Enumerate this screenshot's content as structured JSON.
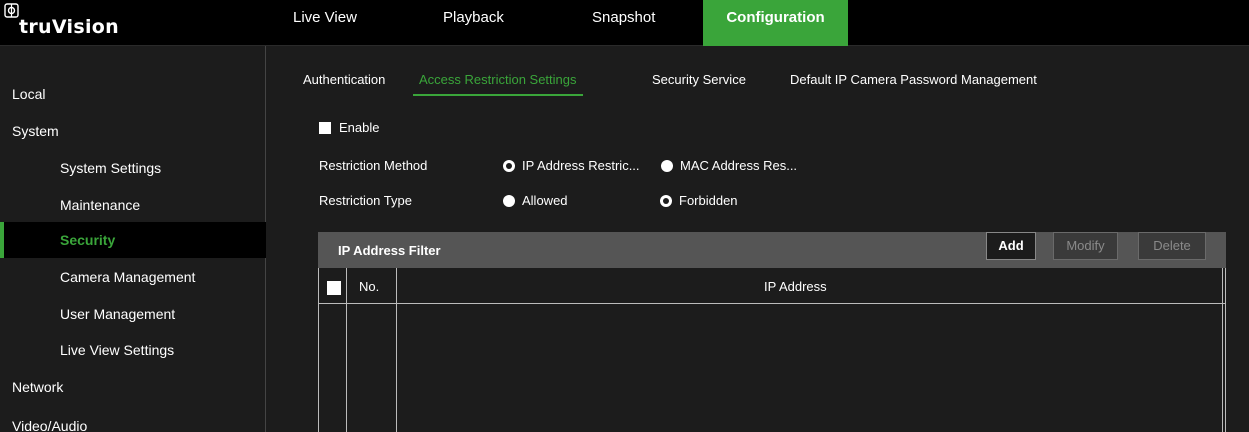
{
  "app": {
    "logo_text": "truVision"
  },
  "nav": {
    "items": [
      {
        "label": "Live View",
        "active": false
      },
      {
        "label": "Playback",
        "active": false
      },
      {
        "label": "Snapshot",
        "active": false
      },
      {
        "label": "Configuration",
        "active": true
      }
    ]
  },
  "sidebar": {
    "items": [
      {
        "label": "Local",
        "level": 0
      },
      {
        "label": "System",
        "level": 0
      },
      {
        "label": "System Settings",
        "level": 1
      },
      {
        "label": "Maintenance",
        "level": 1
      },
      {
        "label": "Security",
        "level": 1,
        "active": true
      },
      {
        "label": "Camera Management",
        "level": 1
      },
      {
        "label": "User Management",
        "level": 1
      },
      {
        "label": "Live View Settings",
        "level": 1
      },
      {
        "label": "Network",
        "level": 0
      },
      {
        "label": "Video/Audio",
        "level": 0
      }
    ]
  },
  "subtabs": [
    {
      "label": "Authentication",
      "active": false
    },
    {
      "label": "Access Restriction Settings",
      "active": true
    },
    {
      "label": "Security Service",
      "active": false
    },
    {
      "label": "Default IP Camera Password Management",
      "active": false
    }
  ],
  "form": {
    "enable_label": "Enable",
    "enable_checked": false,
    "method_label": "Restriction Method",
    "method_options": [
      "IP Address Restric...",
      "MAC Address Res..."
    ],
    "method_selected": "IP Address Restric...",
    "type_label": "Restriction Type",
    "type_options": [
      "Allowed",
      "Forbidden"
    ],
    "type_selected": "Forbidden"
  },
  "filter": {
    "title": "IP Address Filter",
    "buttons": {
      "add": "Add",
      "modify": "Modify",
      "delete": "Delete"
    },
    "columns": {
      "no": "No.",
      "ip": "IP Address"
    },
    "rows": []
  },
  "colors": {
    "accent": "#3aa53a",
    "background": "#1c1c1c",
    "topbar": "#000000",
    "panel_header": "#555555"
  }
}
